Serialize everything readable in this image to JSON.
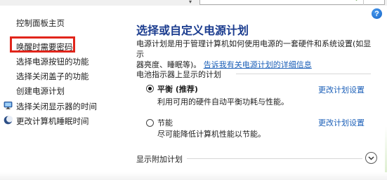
{
  "sidebar": {
    "home": "控制面板主页",
    "items": [
      "唤醒时需要密码",
      "选择电源按钮的功能",
      "选择关闭盖子的功能",
      "创建电源计划",
      "选择关闭显示器的时间",
      "更改计算机睡眠时间"
    ]
  },
  "main": {
    "title": "选择或自定义电源计划",
    "description_line1": "电源计划是用于管理计算机如何使用电源的一套硬件和系统设置(如显示",
    "description_line2": "器亮度、睡眠等)。",
    "description_link": "告诉我有关电源计划的详细信息",
    "group_header": "电池指示器上显示的计划",
    "plans": [
      {
        "name": "平衡 (推荐)",
        "description": "利用可用的硬件自动平衡功耗与性能。",
        "link": "更改计划设置",
        "selected": true
      },
      {
        "name": "节能",
        "description": "尽可能降低计算机性能以节能。",
        "link": "更改计划设置",
        "selected": false
      }
    ],
    "additional_plans": "显示附加计划"
  },
  "colors": {
    "title": "#1c3d8f",
    "link": "#1b5fb8",
    "highlight_box": "#e1251b",
    "help_icon": "#1563c5"
  },
  "icons": {
    "help": "help-icon",
    "display_item": "monitor-icon",
    "sleep_item": "moon-icon",
    "expand": "chevron-down-icon"
  }
}
